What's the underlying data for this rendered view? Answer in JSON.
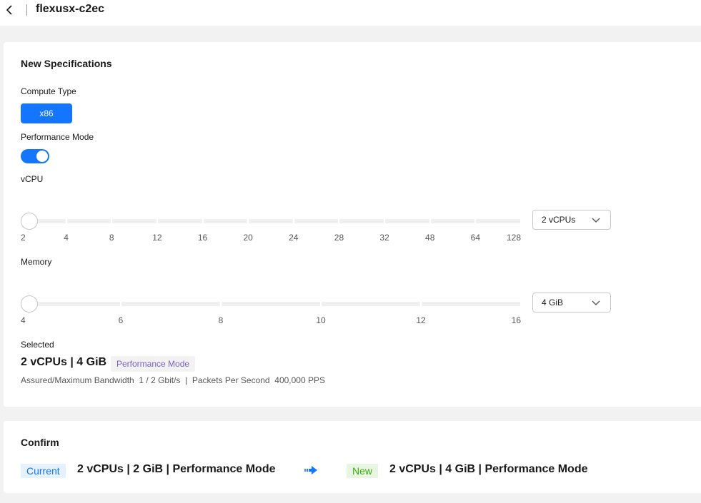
{
  "header": {
    "title": "flexusx-c2ec"
  },
  "spec": {
    "section_title": "New Specifications",
    "compute_type": {
      "label": "Compute Type",
      "value": "x86"
    },
    "performance_mode": {
      "label": "Performance Mode",
      "enabled": true
    },
    "vcpu": {
      "label": "vCPU",
      "ticks": [
        "2",
        "4",
        "8",
        "12",
        "16",
        "20",
        "24",
        "28",
        "32",
        "48",
        "64",
        "128"
      ],
      "selected": "2 vCPUs"
    },
    "memory": {
      "label": "Memory",
      "ticks": [
        "4",
        "6",
        "8",
        "10",
        "12",
        "16"
      ],
      "selected": "4 GiB"
    },
    "selected": {
      "label": "Selected",
      "summary": "2 vCPUs | 4 GiB",
      "badge": "Performance Mode",
      "details": "Assured/Maximum Bandwidth  1 / 2 Gbit/s  |  Packets Per Second  400,000 PPS"
    }
  },
  "confirm": {
    "section_title": "Confirm",
    "current_badge": "Current",
    "current_spec": "2 vCPUs | 2 GiB | Performance Mode",
    "new_badge": "New",
    "new_spec": "2 vCPUs | 4 GiB | Performance Mode"
  },
  "colors": {
    "accent": "#1476ff",
    "new_green": "#42a810",
    "badge_purple": "#7b61c8"
  },
  "icons": {
    "back": "chevron-left-icon",
    "dropdown": "chevron-down-icon",
    "transition": "arrow-right-icon"
  }
}
